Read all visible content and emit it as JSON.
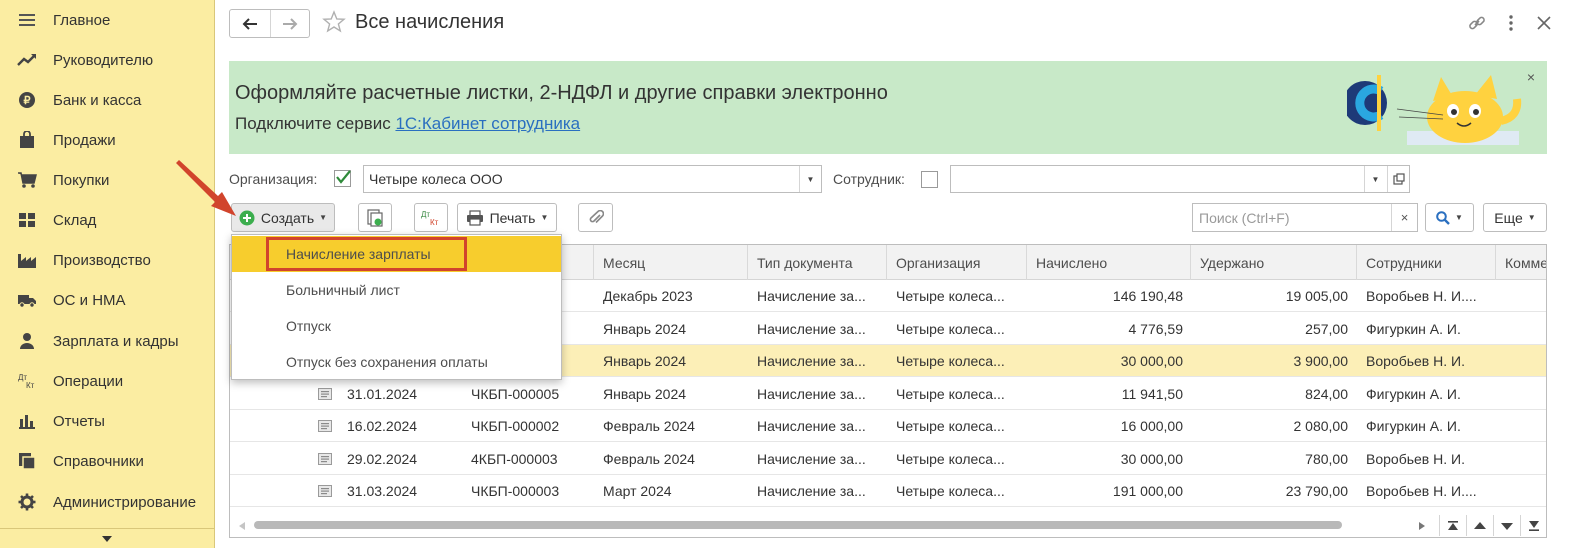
{
  "sidebar": {
    "items": [
      {
        "label": "Главное",
        "icon": "menu-icon"
      },
      {
        "label": "Руководителю",
        "icon": "trend-icon"
      },
      {
        "label": "Банк и касса",
        "icon": "coin-icon"
      },
      {
        "label": "Продажи",
        "icon": "bag-icon"
      },
      {
        "label": "Покупки",
        "icon": "cart-icon"
      },
      {
        "label": "Склад",
        "icon": "warehouse-icon"
      },
      {
        "label": "Производство",
        "icon": "factory-icon"
      },
      {
        "label": "ОС и НМА",
        "icon": "truck-icon"
      },
      {
        "label": "Зарплата и кадры",
        "icon": "person-icon"
      },
      {
        "label": "Операции",
        "icon": "dt-kt-icon"
      },
      {
        "label": "Отчеты",
        "icon": "bar-chart-icon"
      },
      {
        "label": "Справочники",
        "icon": "books-icon"
      },
      {
        "label": "Администрирование",
        "icon": "gear-icon"
      }
    ]
  },
  "header": {
    "title": "Все начисления"
  },
  "banner": {
    "heading": "Оформляйте расчетные листки, 2-НДФЛ и другие справки электронно",
    "subtext_prefix": "Подключите сервис",
    "link": "1С:Кабинет сотрудника",
    "close": "×"
  },
  "filters": {
    "org_label": "Организация:",
    "org_checked": true,
    "org_value": "Четыре колеса ООО",
    "employee_label": "Сотрудник:",
    "employee_checked": false,
    "employee_value": ""
  },
  "toolbar": {
    "create": "Создать",
    "print": "Печать",
    "dtkt_top": "Дт",
    "dtkt_bottom": "Кт",
    "search_placeholder": "Поиск (Ctrl+F)",
    "search_clear": "×",
    "more": "Еще"
  },
  "dropdown": {
    "items": [
      "Начисление зарплаты",
      "Больничный лист",
      "Отпуск",
      "Отпуск без сохранения оплаты"
    ]
  },
  "table": {
    "columns": [
      "Месяц",
      "Тип документа",
      "Организация",
      "Начислено",
      "Удержано",
      "Сотрудники",
      "Комме"
    ],
    "rows": [
      {
        "date": "",
        "number": "",
        "month": "Декабрь 2023",
        "type": "Начисление за...",
        "org": "Четыре колеса...",
        "accrued": "146 190,48",
        "withheld": "19 005,00",
        "employees": "Воробьев Н. И...."
      },
      {
        "date": "",
        "number": "",
        "month": "Январь 2024",
        "type": "Начисление за...",
        "org": "Четыре колеса...",
        "accrued": "4 776,59",
        "withheld": "257,00",
        "employees": "Фигуркин А. И."
      },
      {
        "date": "",
        "number": "",
        "month": "Январь 2024",
        "type": "Начисление за...",
        "org": "Четыре колеса...",
        "accrued": "30 000,00",
        "withheld": "3 900,00",
        "employees": "Воробьев Н. И."
      },
      {
        "date": "31.01.2024",
        "number": "ЧКБП-000005",
        "month": "Январь 2024",
        "type": "Начисление за...",
        "org": "Четыре колеса...",
        "accrued": "11 941,50",
        "withheld": "824,00",
        "employees": "Фигуркин А. И."
      },
      {
        "date": "16.02.2024",
        "number": "ЧКБП-000002",
        "month": "Февраль 2024",
        "type": "Начисление за...",
        "org": "Четыре колеса...",
        "accrued": "16 000,00",
        "withheld": "2 080,00",
        "employees": "Фигуркин А. И."
      },
      {
        "date": "29.02.2024",
        "number": "4КБП-000003",
        "month": "Февраль 2024",
        "type": "Начисление за...",
        "org": "Четыре колеса...",
        "accrued": "30 000,00",
        "withheld": "780,00",
        "employees": "Воробьев Н. И."
      },
      {
        "date": "31.03.2024",
        "number": "ЧКБП-000003",
        "month": "Март 2024",
        "type": "Начисление за...",
        "org": "Четыре колеса...",
        "accrued": "191 000,00",
        "withheld": "23 790,00",
        "employees": "Воробьев Н. И...."
      }
    ]
  },
  "colors": {
    "sidebar_bg": "#fbeda2",
    "banner_bg": "#c8e9c8",
    "link": "#2a6fc0",
    "menu_highlight": "#f7cd2d",
    "annotation_red": "#d1442c",
    "selected_row": "#fcefb7",
    "create_icon_green": "#3cae4e"
  }
}
